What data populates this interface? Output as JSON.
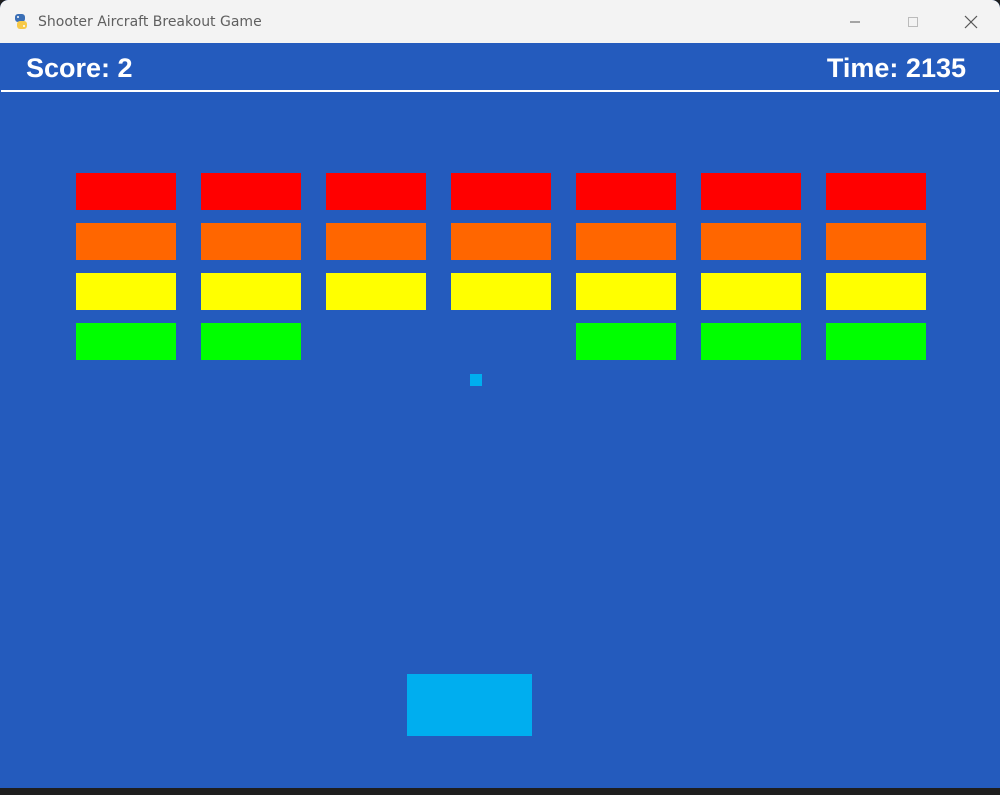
{
  "window": {
    "title": "Shooter Aircraft Breakout Game",
    "app_icon": "python-snake-icon"
  },
  "hud": {
    "score_text": "Score: 2",
    "time_text": "Time: 2135"
  },
  "colors": {
    "background": "#245bbd",
    "hud_text": "#ffffff",
    "ball": "#00aeef",
    "paddle": "#00aeef",
    "row_colors": [
      "#ff0000",
      "#ff6600",
      "#ffff00",
      "#00ff00"
    ]
  },
  "bricks": {
    "rows": 4,
    "columns": 7,
    "present": [
      [
        true,
        true,
        true,
        true,
        true,
        true,
        true
      ],
      [
        true,
        true,
        true,
        true,
        true,
        true,
        true
      ],
      [
        true,
        true,
        true,
        true,
        true,
        true,
        true
      ],
      [
        true,
        true,
        false,
        false,
        true,
        true,
        true
      ]
    ]
  }
}
